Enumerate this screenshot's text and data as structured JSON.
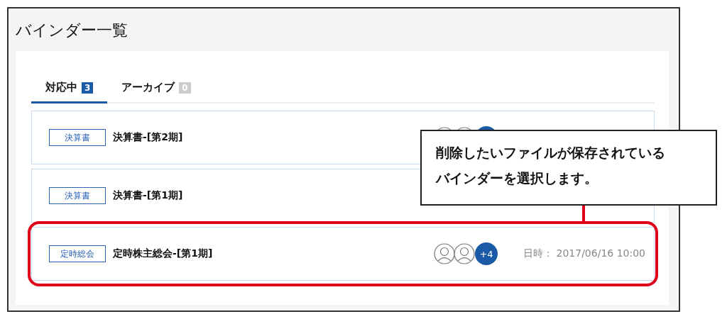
{
  "title": "バインダー一覧",
  "tabs": [
    {
      "label": "対応中",
      "count": "3",
      "selected": true
    },
    {
      "label": "アーカイブ",
      "count": "0",
      "selected": false
    }
  ],
  "binders": [
    {
      "category": "決算書",
      "name": "決算書-[第2期]",
      "members_visible": true,
      "highlighted": false
    },
    {
      "category": "決算書",
      "name": "決算書-[第1期]",
      "members_visible": false,
      "highlighted": false
    },
    {
      "category": "定時総会",
      "name": "定時株主総会-[第1期]",
      "members_visible": true,
      "more_count": "+4",
      "date_label": "日時：",
      "date": "2017/06/16 10:00",
      "highlighted": true
    }
  ],
  "callout": {
    "lines": [
      "削除したいファイルが保存されている",
      "バインダーを選択します。"
    ]
  }
}
